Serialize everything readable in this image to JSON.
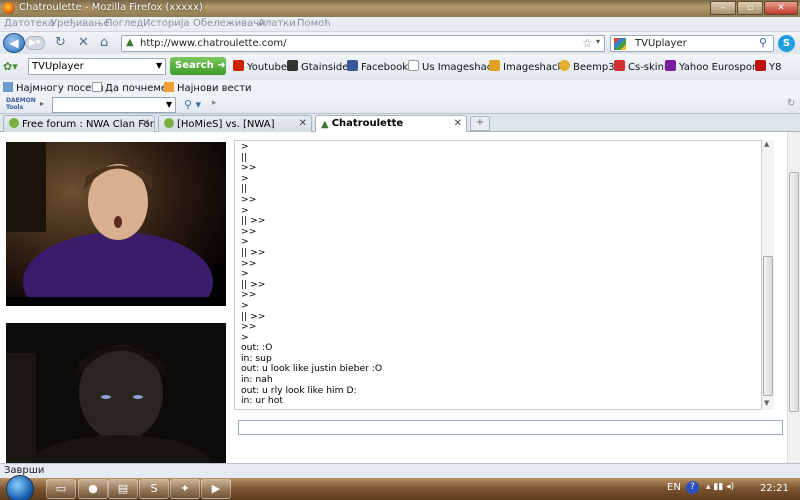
{
  "window": {
    "title": "Chatroulette - Mozilla Firefox (xxxxx)",
    "minimize": "–",
    "maximize": "▫",
    "close": "✕"
  },
  "menu": [
    "Датотека",
    "Уређивање",
    "Поглед",
    "Историја",
    "Обележивачи",
    "Алатки",
    "Помоћ"
  ],
  "nav": {
    "url": "http://www.chatroulette.com/",
    "search_engine_text": "TVUplayer"
  },
  "toolbar": {
    "combo_value": "TVUplayer",
    "search_label": "Search",
    "bookmarks": [
      {
        "label": "Youtube",
        "color": "#cc2200"
      },
      {
        "label": "Gtainside",
        "color": "#333333"
      },
      {
        "label": "Facebook",
        "color": "#3b5998"
      },
      {
        "label": "Us Imageshack",
        "color": "#ffffff"
      },
      {
        "label": "Imageshack",
        "color": "#e0a020"
      },
      {
        "label": "Beemp3",
        "color": "#e0b030"
      },
      {
        "label": "Cs-skini",
        "color": "#d03030"
      },
      {
        "label": "Yahoo Eurosport",
        "color": "#7a1fa0"
      },
      {
        "label": "Y8",
        "color": "#c01010"
      }
    ]
  },
  "bookmarks_bar": [
    {
      "label": "Најмногу посети"
    },
    {
      "label": "Да почнеме!"
    },
    {
      "label": "Најнови вести"
    }
  ],
  "daemon": {
    "logo": "DAEMON Tools"
  },
  "tabs": [
    {
      "label": "Free forum : NWA Clan Forum"
    },
    {
      "label": "[HoMieS] vs. [NWA]"
    },
    {
      "label": "Chatroulette"
    }
  ],
  "chat": {
    "lines": [
      ">",
      "||",
      ">>",
      ">",
      "||",
      ">>",
      ">",
      "|| >>",
      ">>",
      ">",
      "|| >>",
      ">>",
      ">",
      "|| >>",
      ">>",
      ">",
      "|| >>",
      ">>",
      ">",
      "out: :O",
      "in: sup",
      "out: u look like justin bieber :O",
      "in: nah",
      "out: u rly look like him D:",
      "in: ur hot"
    ]
  },
  "status": {
    "text": "Заврши"
  },
  "taskbar": {
    "lang": "EN",
    "help": "?",
    "clock": "22:21"
  }
}
